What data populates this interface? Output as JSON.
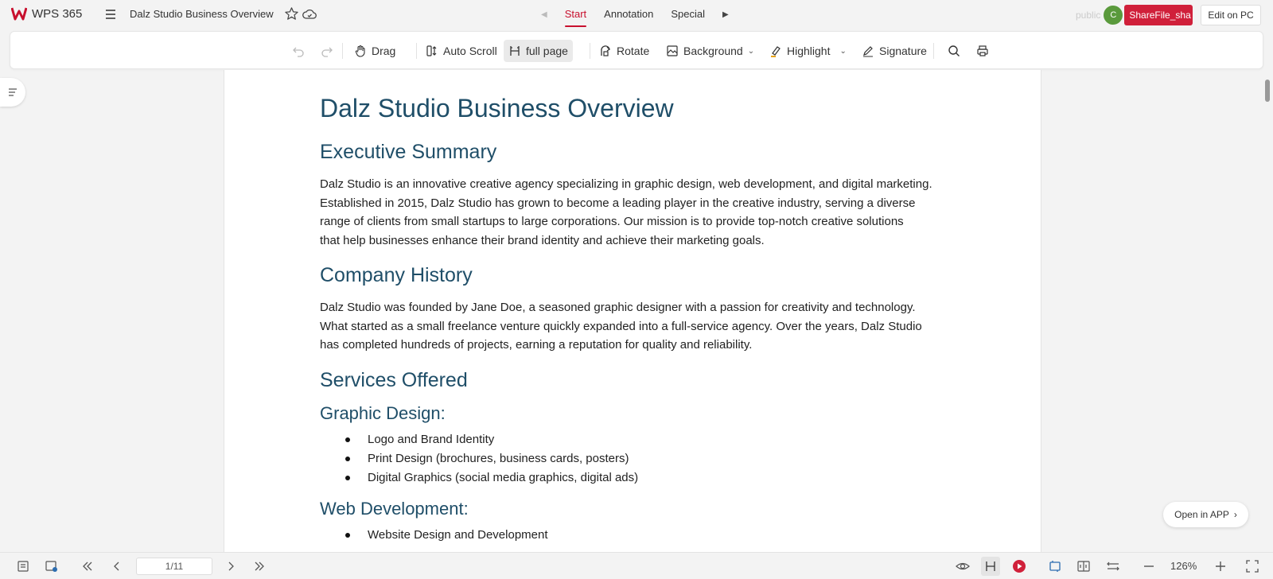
{
  "app": {
    "name": "WPS 365",
    "brand_color": "#c8102e"
  },
  "header": {
    "doc_title": "Dalz Studio Business Overview",
    "tabs": [
      {
        "label": "Start",
        "active": true
      },
      {
        "label": "Annotation",
        "active": false
      },
      {
        "label": "Special",
        "active": false
      }
    ],
    "share_text": "public",
    "avatar_initial": "C",
    "share_label": "ShareFile_sha",
    "edit_pc_label": "Edit on PC"
  },
  "toolbar": {
    "drag": "Drag",
    "auto_scroll": "Auto Scroll",
    "full_page": "full page",
    "rotate": "Rotate",
    "background": "Background",
    "highlight": "Highlight",
    "signature": "Signature"
  },
  "document": {
    "title": "Dalz Studio Business Overview",
    "exec_heading": "Executive Summary",
    "exec_lines": [
      "Dalz Studio is an innovative creative agency specializing in graphic design, web development, and digital marketing.",
      "Established in 2015, Dalz Studio has grown to become a leading player in the creative industry, serving a diverse",
      "range of clients from small startups to large corporations. Our mission is to provide top-notch creative solutions",
      "that help businesses enhance their brand identity and achieve their marketing goals."
    ],
    "history_heading": "Company History",
    "history_lines": [
      "Dalz Studio was founded by Jane Doe, a seasoned graphic designer with a passion for creativity and technology.",
      "What started as a small freelance venture quickly expanded into a full-service agency. Over the years, Dalz Studio",
      "has completed hundreds of projects, earning a reputation for quality and reliability."
    ],
    "services_heading": "Services Offered",
    "graphic_heading": "Graphic Design:",
    "graphic_items": [
      "Logo and Brand Identity",
      "Print Design (brochures, business cards, posters)",
      "Digital Graphics (social media graphics, digital ads)"
    ],
    "web_heading": "Web Development:",
    "web_items": [
      "Website Design and Development"
    ]
  },
  "open_app_label": "Open in APP",
  "statusbar": {
    "page_indicator": "1/11",
    "zoom": "126%"
  }
}
